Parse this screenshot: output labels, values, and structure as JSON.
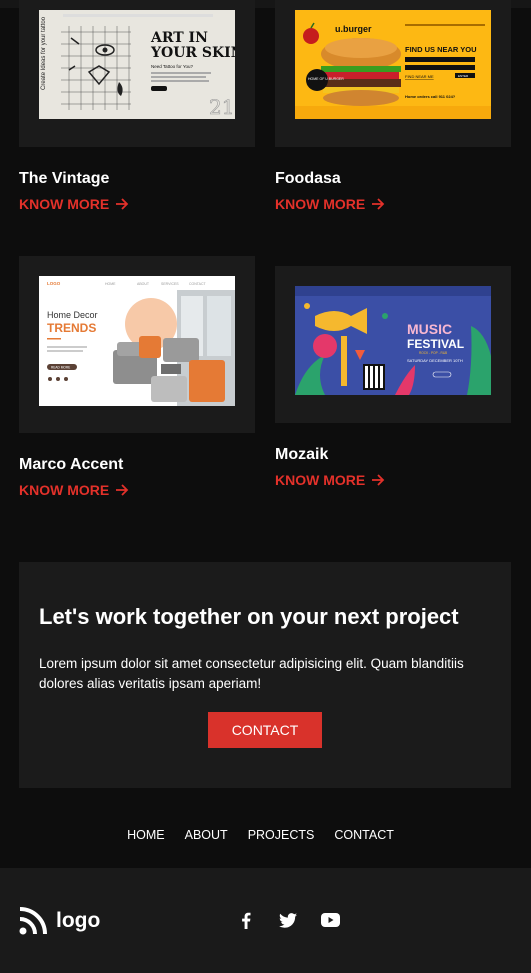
{
  "projects": [
    {
      "title": "The Vintage",
      "link": "KNOW MORE",
      "thumb": {
        "line1": "ART IN",
        "line2": "YOUR SKIN",
        "sub": "Need Tattoo for You?"
      }
    },
    {
      "title": "Foodasa",
      "link": "KNOW MORE",
      "thumb": {
        "brand": "u.burger",
        "heading": "FIND US NEAR YOU",
        "badge": "HOME OF U.BURGER",
        "find": "FIND NEAR ME",
        "enter": "ENTER",
        "note": "Home orders call 911 024?"
      }
    },
    {
      "title": "Marco Accent",
      "link": "KNOW MORE",
      "thumb": {
        "logo": "LOGO",
        "line1": "Home Decor",
        "line2": "TRENDS",
        "cta": "READ MORE",
        "menu": [
          "HOME",
          "ABOUT",
          "SERVICES",
          "CONTACT"
        ]
      }
    },
    {
      "title": "Mozaik",
      "link": "KNOW MORE",
      "thumb": {
        "line1": "MUSIC",
        "line2": "FESTIVAL",
        "date": "SATURDAY DECEMBER 10TH",
        "tag": "ROCK - POP - R&B"
      }
    }
  ],
  "cta": {
    "heading": "Let's work together on your next project",
    "body": "Lorem ipsum dolor sit amet consectetur adipisicing elit. Quam blanditiis dolores alias veritatis ipsam aperiam!",
    "button": "CONTACT"
  },
  "nav": [
    "HOME",
    "ABOUT",
    "PROJECTS",
    "CONTACT"
  ],
  "footer": {
    "logo_text": "logo",
    "social_icons": [
      "facebook-icon",
      "twitter-icon",
      "youtube-icon"
    ]
  },
  "colors": {
    "accent": "#e3312a",
    "card_bg": "#1b1b1b",
    "page_bg": "#0d0d0d",
    "burger_yellow": "#fdb813",
    "festival_blue": "#3b4fa6"
  }
}
